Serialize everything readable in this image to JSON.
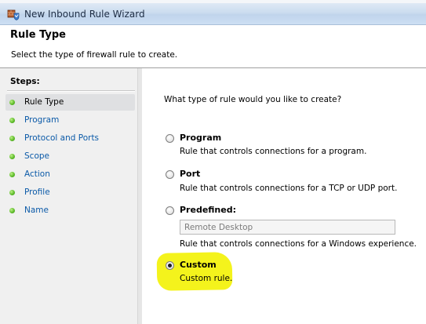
{
  "window": {
    "title": "New Inbound Rule Wizard",
    "icon": "firewall-shield-icon"
  },
  "header": {
    "title": "Rule Type",
    "description": "Select the type of firewall rule to create."
  },
  "steps": {
    "heading": "Steps:",
    "items": [
      {
        "label": "Rule Type",
        "active": true
      },
      {
        "label": "Program",
        "active": false
      },
      {
        "label": "Protocol and Ports",
        "active": false
      },
      {
        "label": "Scope",
        "active": false
      },
      {
        "label": "Action",
        "active": false
      },
      {
        "label": "Profile",
        "active": false
      },
      {
        "label": "Name",
        "active": false
      }
    ],
    "dot_color": "#5fbd2b",
    "link_color": "#0b5aa8"
  },
  "content": {
    "question": "What type of rule would you like to create?",
    "options": [
      {
        "label": "Program",
        "description": "Rule that controls connections for a program.",
        "checked": false
      },
      {
        "label": "Port",
        "description": "Rule that controls connections for a TCP or UDP port.",
        "checked": false
      },
      {
        "label": "Predefined:",
        "description": "Rule that controls connections for a Windows experience.",
        "checked": false
      },
      {
        "label": "Custom",
        "description": "Custom rule.",
        "checked": true
      }
    ],
    "predefined_select": {
      "value": "Remote Desktop",
      "disabled": true
    },
    "highlight_color": "#f4f31c"
  }
}
